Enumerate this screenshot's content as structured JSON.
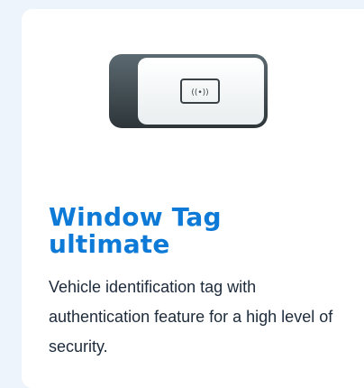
{
  "card": {
    "image": {
      "icon": "window-tag-device-icon",
      "nfc_label": "((•))"
    },
    "title_line1": "Window Tag",
    "title_line2": "ultimate",
    "description": "Vehicle identification tag with authentication feature for a high level of security."
  },
  "colors": {
    "title": "#0c7ad6",
    "text": "#1c2a3a",
    "background": "#eef4fb",
    "card": "#ffffff"
  }
}
